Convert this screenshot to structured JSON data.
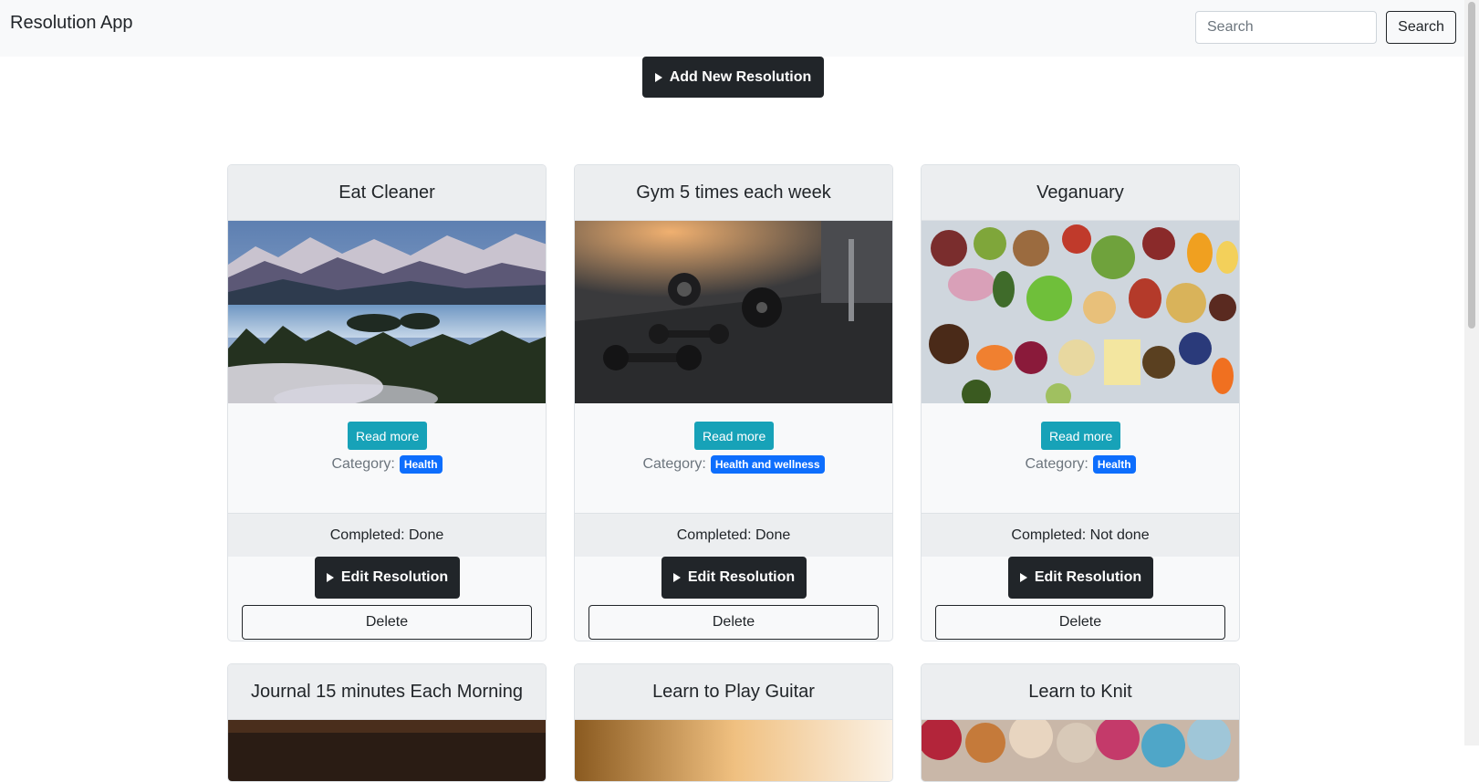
{
  "navbar": {
    "brand": "Resolution App",
    "search_placeholder": "Search",
    "search_value": "",
    "search_button": "Search"
  },
  "add_button": "Add New Resolution",
  "labels": {
    "read_more": "Read more",
    "category_prefix": "Category:",
    "edit": "Edit Resolution",
    "delete": "Delete"
  },
  "cards": [
    {
      "title": "Eat Cleaner",
      "category": "Health",
      "completed": "Completed: Done",
      "image": "mountain-lake-landscape"
    },
    {
      "title": "Gym 5 times each week",
      "category": "Health and wellness",
      "completed": "Completed: Done",
      "image": "gym-dumbbells"
    },
    {
      "title": "Veganuary",
      "category": "Health",
      "completed": "Completed: Not done",
      "image": "vegetables-bowls"
    },
    {
      "title": "Journal 15 minutes Each Morning",
      "image": "dark-wood"
    },
    {
      "title": "Learn to Play Guitar",
      "image": "guitar-warm-light"
    },
    {
      "title": "Learn to Knit",
      "image": "yarn-balls"
    }
  ],
  "colors": {
    "navbar_bg": "#f8f9fa",
    "dark_button": "#212529",
    "info_button": "#17a2b8",
    "badge": "#0d6efd"
  }
}
